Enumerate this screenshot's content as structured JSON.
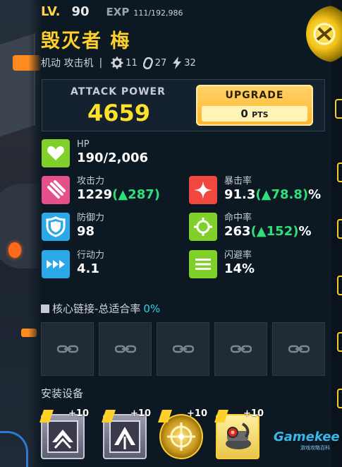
{
  "header": {
    "lv_label": "LV.",
    "lv_value": "90",
    "exp_label": "EXP",
    "exp_value": "111/192,986",
    "name": "毁灭者 梅",
    "type": "机动 攻击机",
    "separator": "|",
    "stat1": "11",
    "stat2": "27",
    "stat3": "32"
  },
  "attack": {
    "label": "ATTACK POWER",
    "value": "4659",
    "upgrade_label": "UPGRADE",
    "upgrade_pts": "0",
    "upgrade_pts_unit": "PTS"
  },
  "stats": {
    "hp": {
      "label": "HP",
      "value": "190/2,006",
      "color": "#7fd12a",
      "icon": "heart-icon"
    },
    "attack": {
      "label": "攻击力",
      "base": "1229",
      "bonus": "(▲287)",
      "suffix": "",
      "color": "#e6508a",
      "icon": "slash-claw-icon"
    },
    "crit": {
      "label": "暴击率",
      "base": "91.3",
      "bonus": "(▲78.8)",
      "suffix": "%",
      "color": "#f0483e",
      "icon": "sparkle-star-icon"
    },
    "defense": {
      "label": "防御力",
      "value": "98",
      "color": "#2aa8e8",
      "icon": "shield-icon"
    },
    "accuracy": {
      "label": "命中率",
      "base": "263",
      "bonus": "(▲152)",
      "suffix": "%",
      "color": "#7fd12a",
      "icon": "crosshair-icon"
    },
    "speed": {
      "label": "行动力",
      "value": "4.1",
      "color": "#2aa8e8",
      "icon": "fast-forward-icon"
    },
    "evasion": {
      "label": "闪避率",
      "value": "14%",
      "color": "#7fd12a",
      "icon": "dash-lines-icon"
    }
  },
  "core_link": {
    "title": "核心链接-总适合率",
    "percent": "0%",
    "slots": 5,
    "slot_icon": "chain-link-icon"
  },
  "equipment": {
    "title": "安装设备",
    "items": [
      {
        "plus": "+10",
        "icon": "chevron-up-equip-icon",
        "color": "#8e8ea0"
      },
      {
        "plus": "+10",
        "icon": "chevron-up-equip-icon",
        "color": "#8e8ea0"
      },
      {
        "plus": "+10",
        "icon": "gold-crosshair-equip-icon",
        "color": "#ffcc30"
      },
      {
        "plus": "+10",
        "icon": "red-core-equip-icon",
        "color": "#ffcc30"
      }
    ]
  },
  "watermark": {
    "logo": "Gamekee",
    "sub": "游戏攻略百科"
  },
  "colors": {
    "accent": "#ffd028",
    "panel": "#142230",
    "green": "#2ee07a"
  }
}
